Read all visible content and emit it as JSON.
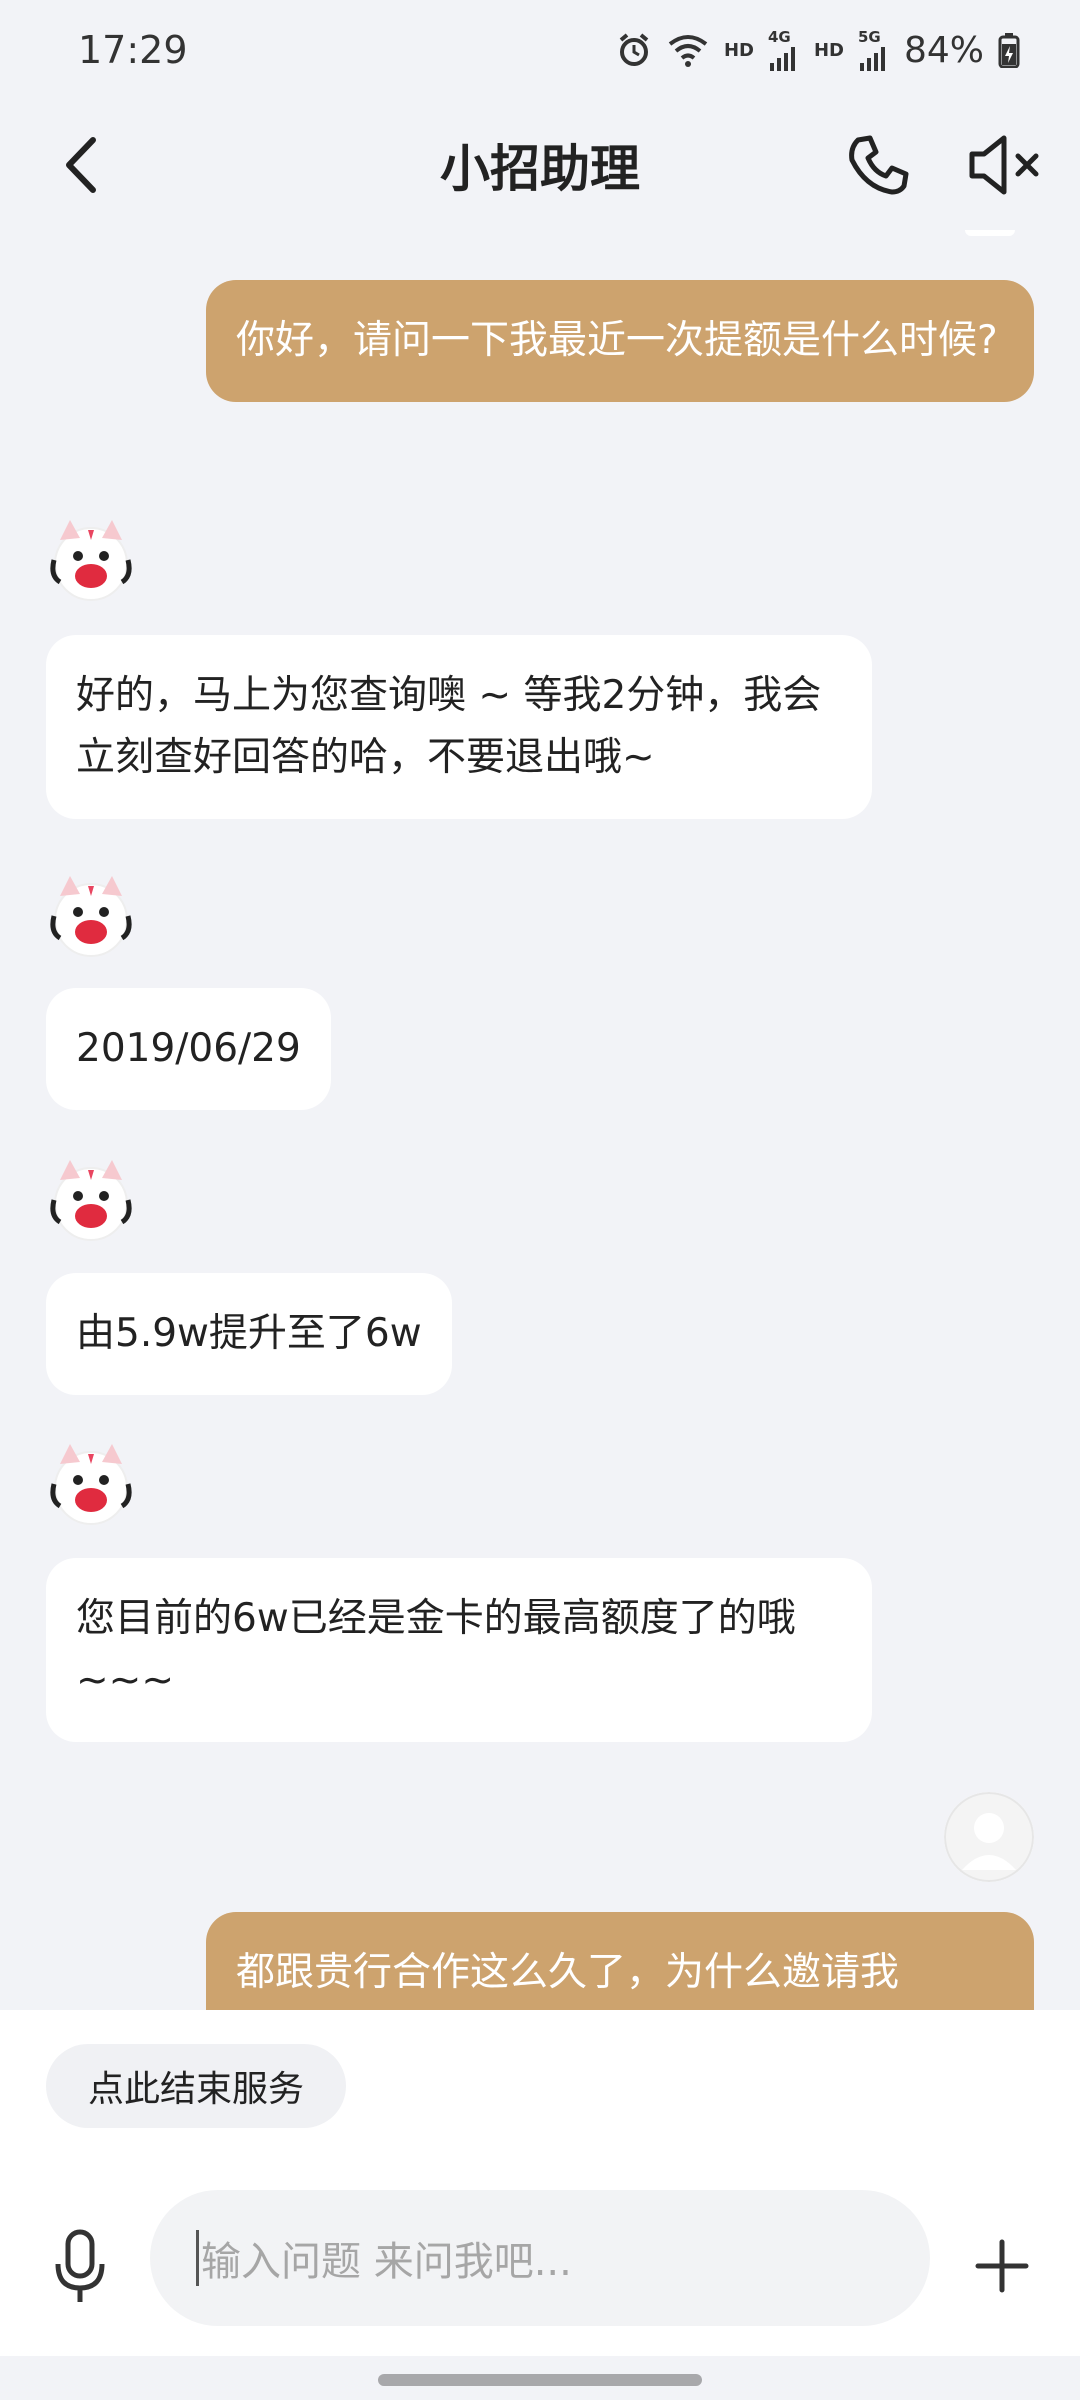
{
  "status_bar": {
    "time": "17:29",
    "hd1": "HD",
    "net1": "4G",
    "hd2": "HD",
    "net2": "5G",
    "battery": "84%"
  },
  "header": {
    "title": "小招助理"
  },
  "messages": [
    {
      "from": "user",
      "text": "你好，请问一下我最近一次提额是什么时候?"
    },
    {
      "from": "bot",
      "text": "好的，马上为您查询噢 ~ 等我2分钟，我会立刻查好回答的哈，不要退出哦~"
    },
    {
      "from": "bot",
      "text": "2019/06/29"
    },
    {
      "from": "bot",
      "text": "由5.9w提升至了6w"
    },
    {
      "from": "bot",
      "text": "您目前的6w已经是金卡的最高额度了的哦~~~"
    },
    {
      "from": "user",
      "text": "都跟贵行合作这么久了，为什么邀请我"
    }
  ],
  "bottom": {
    "end_service_label": "点此结束服务",
    "input_placeholder": "输入问题 来问我吧..."
  },
  "colors": {
    "user_bubble": "#cda36e",
    "bot_bubble": "#ffffff",
    "background": "#f2f3f7"
  }
}
